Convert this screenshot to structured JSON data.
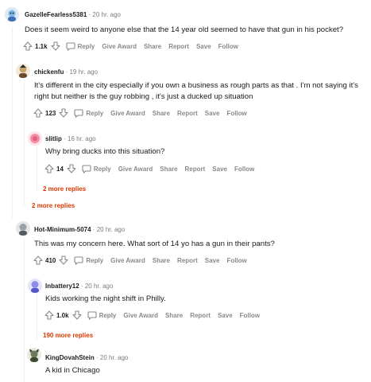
{
  "comments": [
    {
      "username": "GazelleFearless5381",
      "time": "20 hr. ago",
      "body": "Does it seem weird to anyone else that the 14 year old seemed to have that gun in his pocket?",
      "score": "1.1k",
      "avatar_color": "#7fb6e6"
    },
    {
      "username": "chickenfu",
      "time": "19 hr. ago",
      "body_line1": "It's different in the city especially if you own a business as rough parts as that . I'm not saying it's",
      "body_line2": "right but neither is the guy robbing , it's just a ducked up situation",
      "score": "123",
      "avatar_color": "#c9a36b"
    },
    {
      "username": "slitlip",
      "time": "16 hr. ago",
      "body": "Why bring ducks into this situation?",
      "score": "14",
      "avatar_color": "#f48ca5"
    },
    {
      "username": "Hot-Minimum-5074",
      "time": "20 hr. ago",
      "body": "This was my concern here. What sort of 14 yo has a gun in their pants?",
      "score": "410",
      "avatar_color": "#9aa3ab"
    },
    {
      "username": "Inbattery12",
      "time": "20 hr. ago",
      "body": "Kids working the night shift in Philly.",
      "score": "1.0k",
      "avatar_color": "#8c8ee8"
    },
    {
      "username": "KingDovahStein",
      "time": "20 hr. ago",
      "body": "A kid in Chicago",
      "avatar_color": "#6b7a5a"
    }
  ],
  "actions": {
    "reply": "Reply",
    "give_award": "Give Award",
    "share": "Share",
    "report": "Report",
    "save": "Save",
    "follow": "Follow"
  },
  "more_replies_a": "2 more replies",
  "more_replies_b": "2 more replies",
  "more_replies_c": "190 more replies",
  "separator": "·",
  "icons": {
    "upvote": "arrow-up-icon",
    "downvote": "arrow-down-icon",
    "reply": "speech-bubble-icon"
  }
}
